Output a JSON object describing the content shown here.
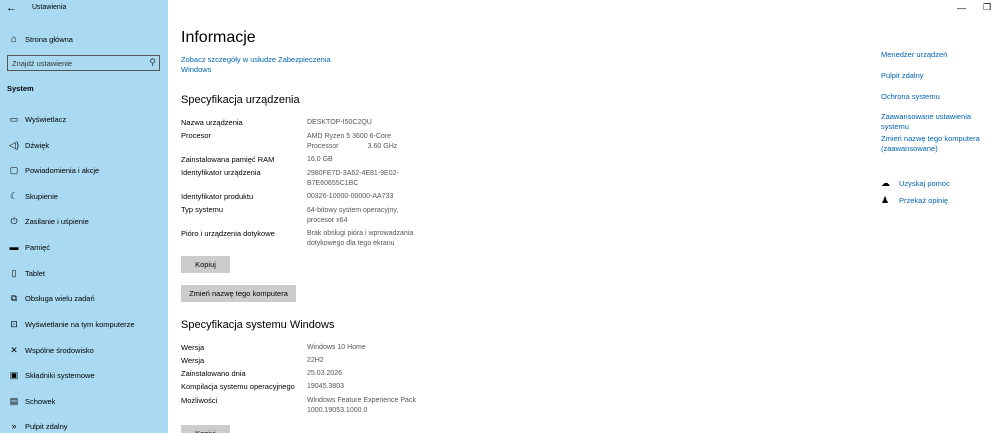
{
  "window": {
    "title": "Ustawienia",
    "back_glyph": "←",
    "minimize_glyph": "—",
    "maximize_glyph": "❐"
  },
  "sidebar": {
    "home": {
      "label": "Strona główna",
      "icon": "home-icon"
    },
    "search": {
      "placeholder": "Znajdź ustawienie",
      "value": ""
    },
    "section_title": "System",
    "items": [
      {
        "label": "Wyświetlacz",
        "icon": "display-icon"
      },
      {
        "label": "Dźwięk",
        "icon": "sound-icon"
      },
      {
        "label": "Powiadomienia i akcje",
        "icon": "notifications-icon"
      },
      {
        "label": "Skupienie",
        "icon": "focus-icon"
      },
      {
        "label": "Zasilanie i uśpienie",
        "icon": "power-icon"
      },
      {
        "label": "Pamięć",
        "icon": "storage-icon"
      },
      {
        "label": "Tablet",
        "icon": "tablet-icon"
      },
      {
        "label": "Obsługa wielu zadań",
        "icon": "multitasking-icon"
      },
      {
        "label": "Wyświetlanie na tym komputerze",
        "icon": "projecting-icon"
      },
      {
        "label": "Wspólne środowisko",
        "icon": "shared-experiences-icon"
      },
      {
        "label": "Składniki systemowe",
        "icon": "system-components-icon"
      },
      {
        "label": "Schowek",
        "icon": "clipboard-icon"
      },
      {
        "label": "Pulpit zdalny",
        "icon": "remote-desktop-icon"
      }
    ]
  },
  "main": {
    "title": "Informacje",
    "security_link": {
      "line1": "Zobacz szczegóły w usłudze Zabezpieczenia",
      "line2": "Windows"
    },
    "device_specs": {
      "heading": "Specyfikacja urządzenia",
      "rows": [
        {
          "label": "Nazwa urządzenia",
          "value": [
            "DESKTOP-I50C2QU"
          ]
        },
        {
          "label": "Procesor",
          "value": [
            "AMD Ryzen 5 3600 6-Core",
            "Processor               3.60 GHz"
          ]
        },
        {
          "label": "Zainstalowana pamięć RAM",
          "value": [
            "16,0 GB"
          ]
        },
        {
          "label": "Identyfikator urządzenia",
          "value": [
            "2980FE7D-3A62-4E81-9E02-",
            "B7E60655C1BC"
          ]
        },
        {
          "label": "Identyfikator produktu",
          "value": [
            "00326-10000-00000-AA733"
          ]
        },
        {
          "label": "Typ systemu",
          "value": [
            "64-bitowy system operacyjny,",
            "procesor x64"
          ]
        },
        {
          "label": "Pióro i urządzenia dotykowe",
          "value": [
            "Brak obsługi pióra i wprowadzania",
            "dotykowego dla tego ekranu"
          ]
        }
      ],
      "copy_button": "Kopiuj",
      "rename_button": "Zmień nazwę tego komputera"
    },
    "windows_specs": {
      "heading": "Specyfikacja systemu Windows",
      "rows": [
        {
          "label": "Wersja",
          "value": [
            "Windows 10 Home"
          ]
        },
        {
          "label": "Wersja",
          "value": [
            "22H2"
          ]
        },
        {
          "label": "Zainstalowano dnia",
          "value": [
            "25.03.2026"
          ]
        },
        {
          "label": "Kompilacja systemu operacyjnego",
          "value": [
            "19045.3803"
          ]
        },
        {
          "label": "Możliwości",
          "value": [
            "Windows Feature Experience Pack",
            "1000.19053.1000.0"
          ]
        }
      ],
      "copy_button": "Kopiuj"
    }
  },
  "related": {
    "links": [
      {
        "lines": [
          "Menedżer urządzeń"
        ]
      },
      {
        "lines": [
          "Pulpit zdalny"
        ]
      },
      {
        "lines": [
          "Ochrona systemu"
        ]
      },
      {
        "lines": [
          "Zaawansowane ustawienia systemu"
        ]
      },
      {
        "lines": [
          "Zmień nazwę tego komputera",
          "(zaawansowane)"
        ]
      }
    ],
    "help": [
      {
        "label": "Uzyskaj pomoc",
        "icon": "help-chat-icon"
      },
      {
        "label": "Przekaż opinię",
        "icon": "feedback-icon"
      }
    ]
  },
  "colors": {
    "sidebar_bg": "#a9daf2",
    "link": "#0063b1",
    "button_bg": "#cccccc"
  }
}
